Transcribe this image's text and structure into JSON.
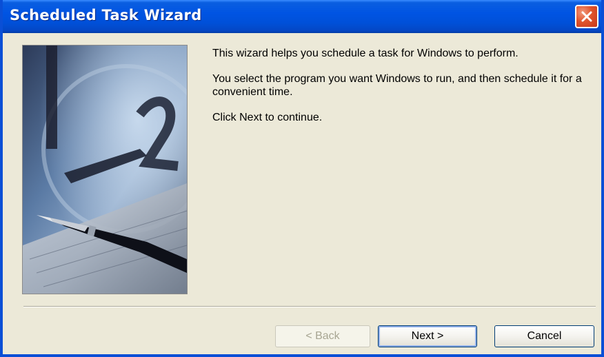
{
  "window": {
    "title": "Scheduled Task Wizard"
  },
  "icons": {
    "close": "close-icon",
    "hero": "clock-and-pen-illustration"
  },
  "content": {
    "paragraphs": [
      "This wizard helps you schedule a task for Windows to perform.",
      "You select the program you want Windows to run, and then schedule it for a convenient time.",
      "Click Next to continue."
    ]
  },
  "buttons": {
    "back": "< Back",
    "next": "Next >",
    "cancel": "Cancel"
  },
  "colors": {
    "titlebar": "#0054e3",
    "close": "#e0542c",
    "background": "#ece9d8"
  }
}
